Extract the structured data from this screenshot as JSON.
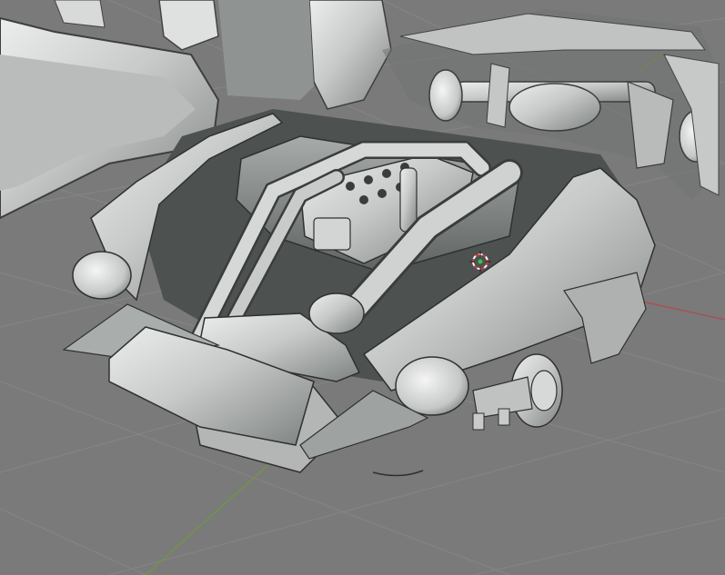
{
  "viewport": {
    "mode": "3d-viewport-solid-shading",
    "background_color": "#7a7a7a",
    "grid_color": "#8a8a8a",
    "x_axis_color": "#b14a4a",
    "y_axis_color": "#6f9a3a",
    "model_color": "#c8cac9",
    "model_shadow_color": "#555a58",
    "cursor_colors": {
      "ring_a": "#d93a3a",
      "ring_b": "#ffffff",
      "center": "#3cc33c"
    }
  },
  "scene": {
    "object": "car-body-shell-with-engine",
    "icons": [
      "3d-cursor-icon"
    ]
  }
}
